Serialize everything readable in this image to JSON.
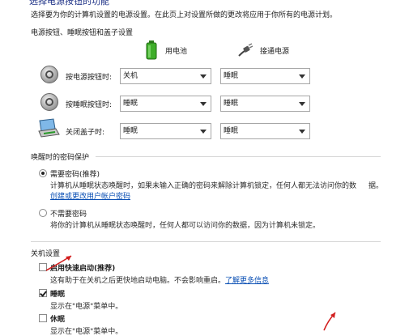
{
  "header": {
    "cut_title": "选择电源按钮的功能",
    "intro": "选择要为你的计算机设置的电源设置。在此页上对设置所做的更改将应用于你所有的电源计划。"
  },
  "power_buttons": {
    "section_title": "电源按钮、睡眠按钮和盖子设置",
    "col_battery": "用电池",
    "col_plugged": "接通电源",
    "rows": [
      {
        "label": "按电源按钮时:",
        "battery": "关机",
        "plugged": "睡眠"
      },
      {
        "label": "按睡眠按钮时:",
        "battery": "睡眠",
        "plugged": "睡眠"
      },
      {
        "label": "关闭盖子时:",
        "battery": "睡眠",
        "plugged": "睡眠"
      }
    ]
  },
  "wake_password": {
    "section_title": "唤醒时的密码保护",
    "require": {
      "label": "需要密码(推荐)",
      "desc": "计算机从睡眠状态唤醒时，如果未输入正确的密码来解除计算机锁定，任何人都无法访问你的数",
      "desc2": "据。",
      "link": "创建或更改用户帐户密码"
    },
    "not_require": {
      "label": "不需要密码",
      "desc": "将你的计算机从睡眠状态唤醒时，任何人都可以访问你的数据，因为计算机未锁定。"
    }
  },
  "shutdown": {
    "section_title": "关机设置",
    "fast_startup": {
      "label": "启用快速启动(推荐)",
      "desc": "这有助于在关机之后更快地启动电脑。不会影响重启。",
      "link": "了解更多信息",
      "checked": false
    },
    "sleep": {
      "label": "睡眠",
      "desc": "显示在\"电源\"菜单中。",
      "checked": true
    },
    "hibernate": {
      "label": "休眠",
      "desc": "显示在\"电源\"菜单中。",
      "checked": false
    }
  },
  "colors": {
    "link": "#0a4fb4",
    "annotation_arrow": "#d21e1e"
  }
}
